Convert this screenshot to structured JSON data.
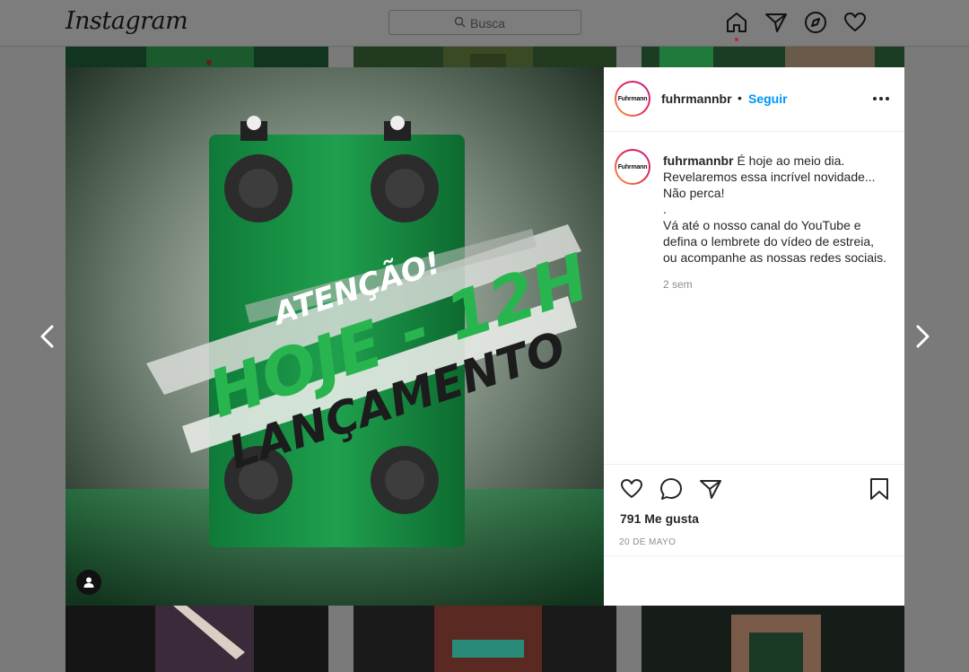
{
  "app": {
    "logo": "Instagram"
  },
  "search": {
    "placeholder": "Busca"
  },
  "nav": {
    "icons": [
      "home-icon",
      "direct-icon",
      "explore-icon",
      "activity-icon"
    ]
  },
  "post": {
    "image": {
      "headline_1": "ATENÇÃO!",
      "headline_2": "HOJE - 12H",
      "headline_3": "LANÇAMENTO",
      "brand_color": "#1f9a4a"
    },
    "author": {
      "username": "fuhrmannbr",
      "avatar_text": "Fuhrmann",
      "separator": "•",
      "follow_label": "Seguir"
    },
    "caption": {
      "username": "fuhrmannbr",
      "lines": [
        "É hoje ao meio dia.",
        "Revelaremos essa incrível novidade...",
        "Não perca!",
        ".",
        "Vá até o nosso canal do YouTube e",
        "defina o lembrete do vídeo de estreia,",
        "ou acompanhe as nossas redes sociais."
      ],
      "time": "2 sem"
    },
    "likes": "791 Me gusta",
    "date": "20 DE MAYO"
  },
  "colors": {
    "accent": "#0095f6",
    "notification_dot": "#c0243b"
  }
}
